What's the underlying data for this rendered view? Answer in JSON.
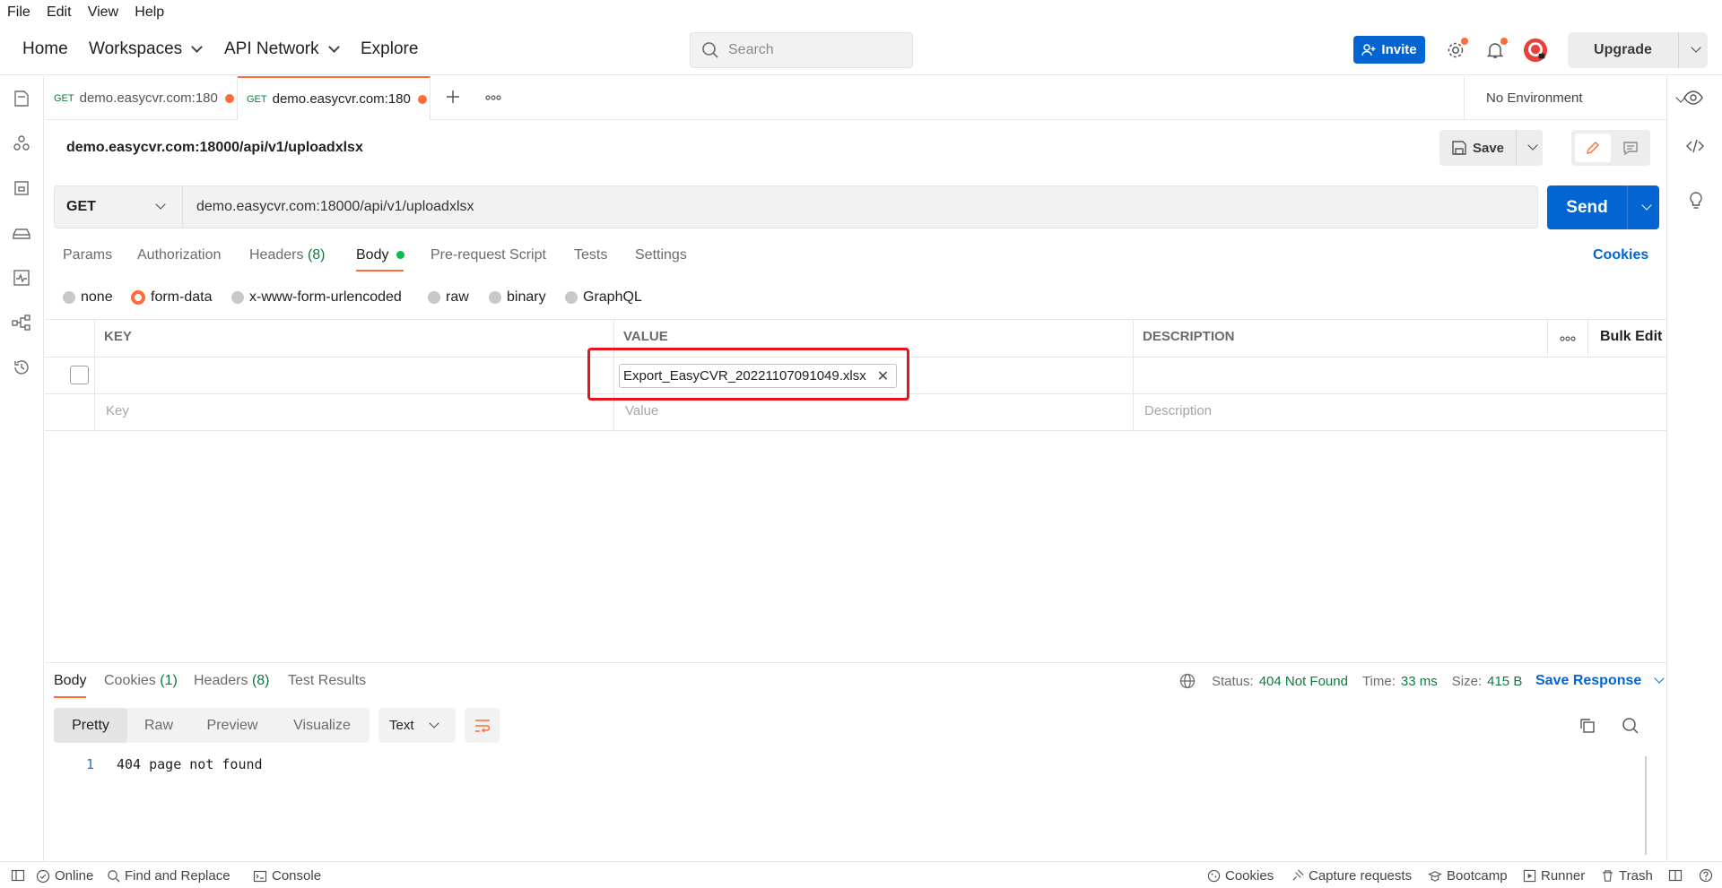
{
  "menu": [
    "File",
    "Edit",
    "View",
    "Help"
  ],
  "header": {
    "nav": [
      "Home",
      "Workspaces",
      "API Network",
      "Explore"
    ],
    "search_placeholder": "Search",
    "invite_label": "Invite",
    "upgrade_label": "Upgrade"
  },
  "tabs": [
    {
      "method": "GET",
      "label": "demo.easycvr.com:180"
    },
    {
      "method": "GET",
      "label": "demo.easycvr.com:180"
    }
  ],
  "environment": "No Environment",
  "request": {
    "title": "demo.easycvr.com:18000/api/v1/uploadxlsx",
    "save_label": "Save",
    "method": "GET",
    "url": "demo.easycvr.com:18000/api/v1/uploadxlsx",
    "send_label": "Send"
  },
  "subtabs": {
    "params": "Params",
    "authorization": "Authorization",
    "headers": "Headers",
    "headers_count": "(8)",
    "body": "Body",
    "pre_request": "Pre-request Script",
    "tests": "Tests",
    "settings": "Settings",
    "cookies": "Cookies"
  },
  "body_types": [
    "none",
    "form-data",
    "x-www-form-urlencoded",
    "raw",
    "binary",
    "GraphQL"
  ],
  "body_type_selected": "form-data",
  "table": {
    "headers": [
      "KEY",
      "VALUE",
      "DESCRIPTION"
    ],
    "bulk_edit": "Bulk Edit",
    "row_file": "Export_EasyCVR_20221107091049.xlsx",
    "placeholders": [
      "Key",
      "Value",
      "Description"
    ]
  },
  "response": {
    "tabs": {
      "body": "Body",
      "cookies": "Cookies",
      "cookies_count": "(1)",
      "headers": "Headers",
      "headers_count": "(8)",
      "test_results": "Test Results"
    },
    "status_label": "Status:",
    "status_value": "404 Not Found",
    "time_label": "Time:",
    "time_value": "33 ms",
    "size_label": "Size:",
    "size_value": "415 B",
    "save_response": "Save Response",
    "views": [
      "Pretty",
      "Raw",
      "Preview",
      "Visualize"
    ],
    "format": "Text",
    "line_number": "1",
    "code_line": "404 page not found"
  },
  "statusbar": {
    "online": "Online",
    "find_replace": "Find and Replace",
    "console": "Console",
    "cookies": "Cookies",
    "capture": "Capture requests",
    "bootcamp": "Bootcamp",
    "runner": "Runner",
    "trash": "Trash"
  },
  "colors": {
    "accent": "#ff6c37",
    "primary": "#0265d2",
    "success": "#0c7b3d",
    "highlight": "#e8141c"
  }
}
